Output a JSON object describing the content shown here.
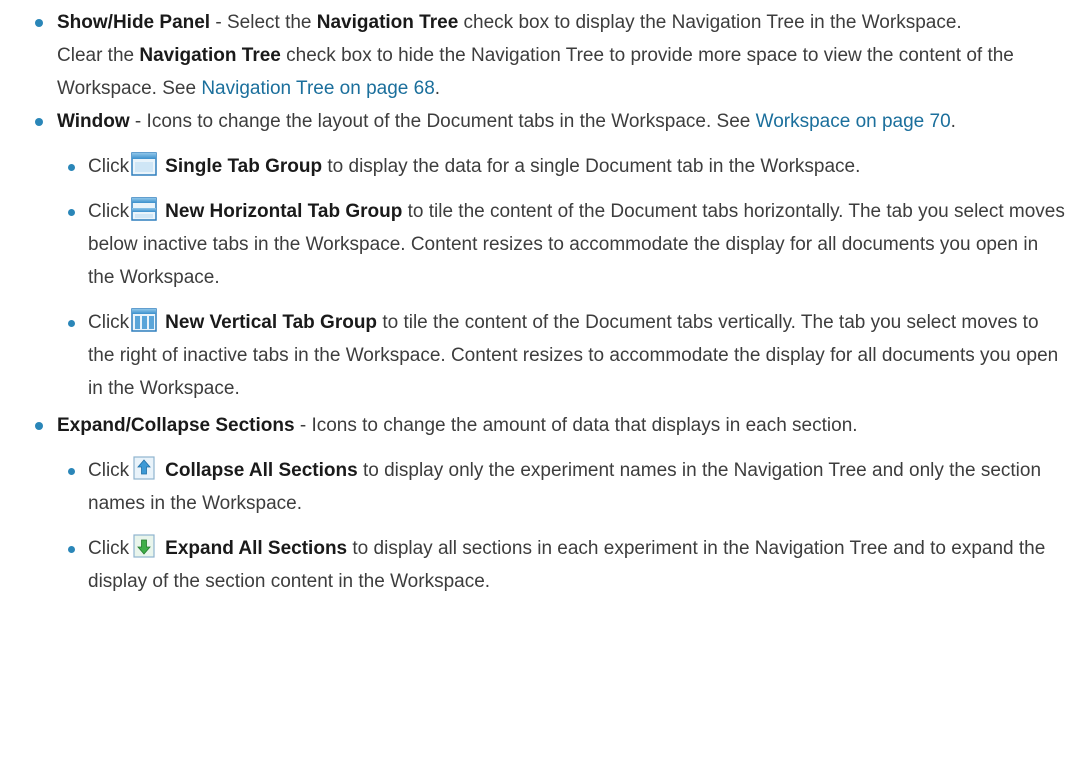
{
  "items": [
    {
      "term": "Show/Hide Panel",
      "pre": " - Select the ",
      "bold1": "Navigation Tree",
      "mid1": " check box to display the Navigation Tree in the Workspace.",
      "line2_pre": "Clear the ",
      "bold2": "Navigation Tree",
      "line2_mid": " check box to hide the Navigation Tree to provide more space to view the content of the Workspace. See ",
      "link": "Navigation Tree on page 68",
      "end": "."
    },
    {
      "term": "Window",
      "text": " - Icons to change the layout of the Document tabs in the Workspace. See ",
      "link": "Workspace on page 70",
      "end": ".",
      "subitems": [
        {
          "click": "Click",
          "icon": "single-tab-group-icon",
          "label": "Single Tab Group",
          "text": " to display the data for a single Document tab in the Workspace."
        },
        {
          "click": "Click",
          "icon": "horizontal-tab-group-icon",
          "label": "New Horizontal Tab Group",
          "text": " to tile the content of the Document tabs horizontally. The tab you select moves below inactive tabs in the Workspace. Content resizes to accommodate the display for all documents you open in the Workspace."
        },
        {
          "click": "Click",
          "icon": "vertical-tab-group-icon",
          "label": "New Vertical Tab Group",
          "text": " to tile the content of the Document tabs vertically. The tab you select moves to the right of inactive tabs in the Workspace. Content resizes to accommodate the display for all documents you open in the Workspace."
        }
      ]
    },
    {
      "term": "Expand/Collapse Sections",
      "text": " - Icons to change the amount of data that displays in each section.",
      "subitems": [
        {
          "click": "Click",
          "icon": "collapse-all-sections-icon",
          "label": "Collapse All Sections",
          "text": " to display only the experiment names in the Navigation Tree and only the section names in the Workspace."
        },
        {
          "click": "Click",
          "icon": "expand-all-sections-icon",
          "label": "Expand All Sections",
          "text": " to display all sections in each experiment in the Navigation Tree and to expand the display of the section content in the Workspace."
        }
      ]
    }
  ]
}
